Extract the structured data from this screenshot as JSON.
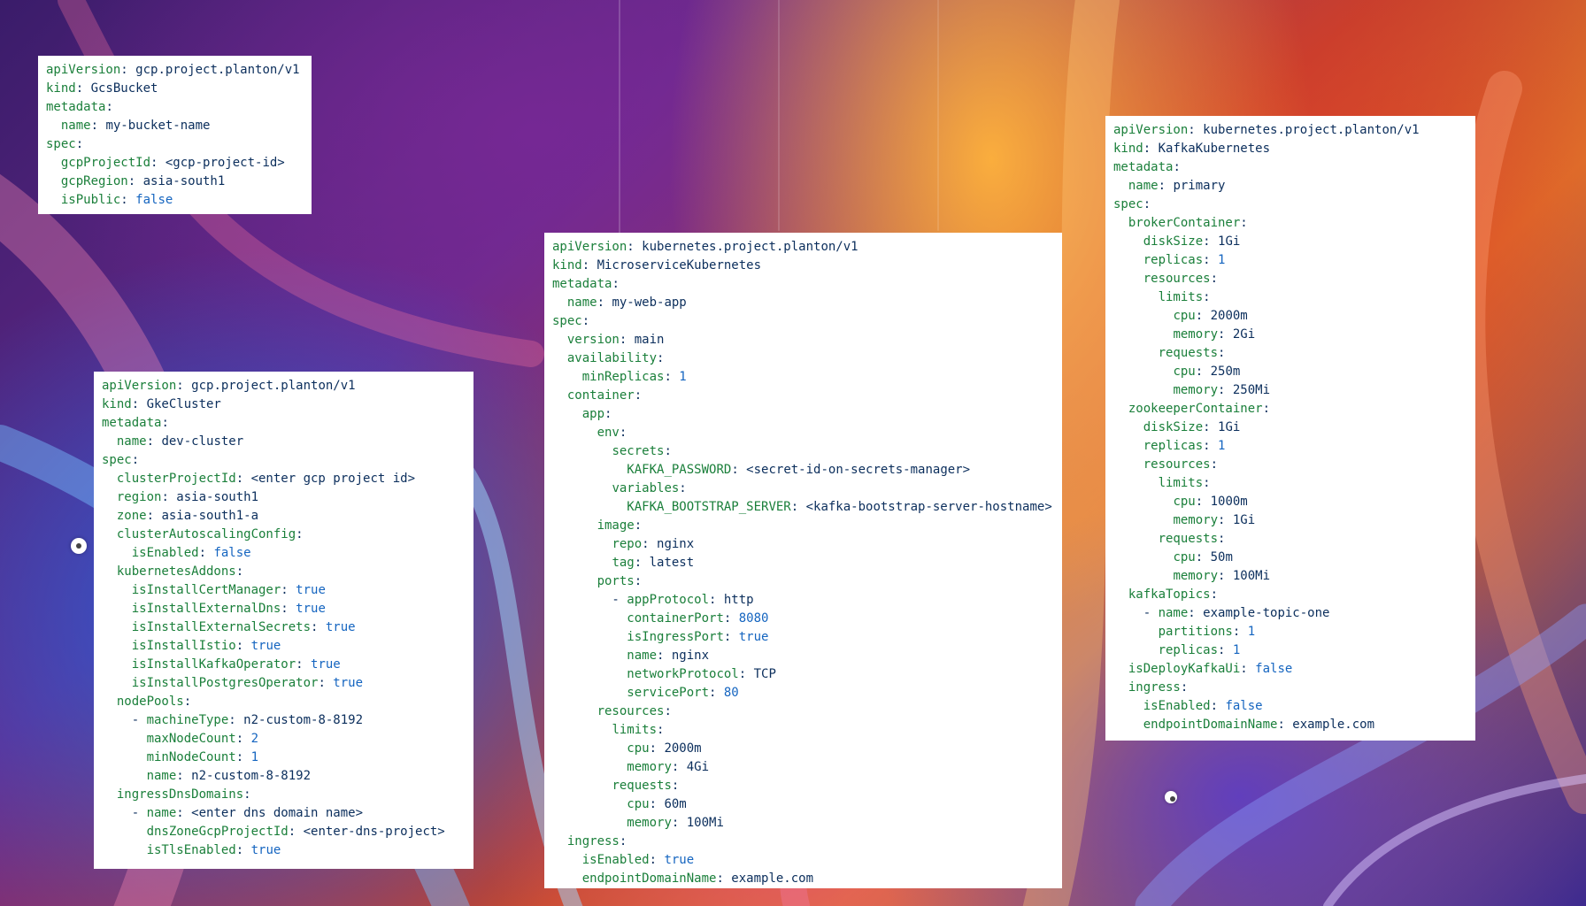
{
  "cards": {
    "gcs": {
      "lines": [
        {
          "indent": 0,
          "key": "apiVersion",
          "value": "gcp.project.planton/v1",
          "type": "s"
        },
        {
          "indent": 0,
          "key": "kind",
          "value": "GcsBucket",
          "type": "s"
        },
        {
          "indent": 0,
          "key": "metadata",
          "value": "",
          "type": "s"
        },
        {
          "indent": 1,
          "key": "name",
          "value": "my-bucket-name",
          "type": "s"
        },
        {
          "indent": 0,
          "key": "spec",
          "value": "",
          "type": "s"
        },
        {
          "indent": 1,
          "key": "gcpProjectId",
          "value": "<gcp-project-id>",
          "type": "s"
        },
        {
          "indent": 1,
          "key": "gcpRegion",
          "value": "asia-south1",
          "type": "s"
        },
        {
          "indent": 1,
          "key": "isPublic",
          "value": "false",
          "type": "n"
        }
      ]
    },
    "gke": {
      "lines": [
        {
          "indent": 0,
          "key": "apiVersion",
          "value": "gcp.project.planton/v1",
          "type": "s"
        },
        {
          "indent": 0,
          "key": "kind",
          "value": "GkeCluster",
          "type": "s"
        },
        {
          "indent": 0,
          "key": "metadata",
          "value": "",
          "type": "s"
        },
        {
          "indent": 1,
          "key": "name",
          "value": "dev-cluster",
          "type": "s"
        },
        {
          "indent": 0,
          "key": "spec",
          "value": "",
          "type": "s"
        },
        {
          "indent": 1,
          "key": "clusterProjectId",
          "value": "<enter gcp project id>",
          "type": "s"
        },
        {
          "indent": 1,
          "key": "region",
          "value": "asia-south1",
          "type": "s"
        },
        {
          "indent": 1,
          "key": "zone",
          "value": "asia-south1-a",
          "type": "s"
        },
        {
          "indent": 1,
          "key": "clusterAutoscalingConfig",
          "value": "",
          "type": "s"
        },
        {
          "indent": 2,
          "key": "isEnabled",
          "value": "false",
          "type": "n"
        },
        {
          "indent": 1,
          "key": "kubernetesAddons",
          "value": "",
          "type": "s"
        },
        {
          "indent": 2,
          "key": "isInstallCertManager",
          "value": "true",
          "type": "n"
        },
        {
          "indent": 2,
          "key": "isInstallExternalDns",
          "value": "true",
          "type": "n"
        },
        {
          "indent": 2,
          "key": "isInstallExternalSecrets",
          "value": "true",
          "type": "n"
        },
        {
          "indent": 2,
          "key": "isInstallIstio",
          "value": "true",
          "type": "n"
        },
        {
          "indent": 2,
          "key": "isInstallKafkaOperator",
          "value": "true",
          "type": "n"
        },
        {
          "indent": 2,
          "key": "isInstallPostgresOperator",
          "value": "true",
          "type": "n"
        },
        {
          "indent": 1,
          "key": "nodePools",
          "value": "",
          "type": "s"
        },
        {
          "indent": 2,
          "dash": true,
          "key": "machineType",
          "value": "n2-custom-8-8192",
          "type": "s"
        },
        {
          "indent": 3,
          "key": "maxNodeCount",
          "value": "2",
          "type": "n"
        },
        {
          "indent": 3,
          "key": "minNodeCount",
          "value": "1",
          "type": "n"
        },
        {
          "indent": 3,
          "key": "name",
          "value": "n2-custom-8-8192",
          "type": "s"
        },
        {
          "indent": 1,
          "key": "ingressDnsDomains",
          "value": "",
          "type": "s"
        },
        {
          "indent": 2,
          "dash": true,
          "key": "name",
          "value": "<enter dns domain name>",
          "type": "s"
        },
        {
          "indent": 3,
          "key": "dnsZoneGcpProjectId",
          "value": "<enter-dns-project>",
          "type": "s"
        },
        {
          "indent": 3,
          "key": "isTlsEnabled",
          "value": "true",
          "type": "n"
        }
      ]
    },
    "micro": {
      "lines": [
        {
          "indent": 0,
          "key": "apiVersion",
          "value": "kubernetes.project.planton/v1",
          "type": "s"
        },
        {
          "indent": 0,
          "key": "kind",
          "value": "MicroserviceKubernetes",
          "type": "s"
        },
        {
          "indent": 0,
          "key": "metadata",
          "value": "",
          "type": "s"
        },
        {
          "indent": 1,
          "key": "name",
          "value": "my-web-app",
          "type": "s"
        },
        {
          "indent": 0,
          "key": "spec",
          "value": "",
          "type": "s"
        },
        {
          "indent": 1,
          "key": "version",
          "value": "main",
          "type": "s"
        },
        {
          "indent": 1,
          "key": "availability",
          "value": "",
          "type": "s"
        },
        {
          "indent": 2,
          "key": "minReplicas",
          "value": "1",
          "type": "n"
        },
        {
          "indent": 1,
          "key": "container",
          "value": "",
          "type": "s"
        },
        {
          "indent": 2,
          "key": "app",
          "value": "",
          "type": "s"
        },
        {
          "indent": 3,
          "key": "env",
          "value": "",
          "type": "s"
        },
        {
          "indent": 4,
          "key": "secrets",
          "value": "",
          "type": "s"
        },
        {
          "indent": 5,
          "key": "KAFKA_PASSWORD",
          "value": "<secret-id-on-secrets-manager>",
          "type": "s"
        },
        {
          "indent": 4,
          "key": "variables",
          "value": "",
          "type": "s"
        },
        {
          "indent": 5,
          "key": "KAFKA_BOOTSTRAP_SERVER",
          "value": "<kafka-bootstrap-server-hostname>",
          "type": "s"
        },
        {
          "indent": 3,
          "key": "image",
          "value": "",
          "type": "s"
        },
        {
          "indent": 4,
          "key": "repo",
          "value": "nginx",
          "type": "s"
        },
        {
          "indent": 4,
          "key": "tag",
          "value": "latest",
          "type": "s"
        },
        {
          "indent": 3,
          "key": "ports",
          "value": "",
          "type": "s"
        },
        {
          "indent": 4,
          "dash": true,
          "key": "appProtocol",
          "value": "http",
          "type": "s"
        },
        {
          "indent": 5,
          "key": "containerPort",
          "value": "8080",
          "type": "n"
        },
        {
          "indent": 5,
          "key": "isIngressPort",
          "value": "true",
          "type": "n"
        },
        {
          "indent": 5,
          "key": "name",
          "value": "nginx",
          "type": "s"
        },
        {
          "indent": 5,
          "key": "networkProtocol",
          "value": "TCP",
          "type": "s"
        },
        {
          "indent": 5,
          "key": "servicePort",
          "value": "80",
          "type": "n"
        },
        {
          "indent": 3,
          "key": "resources",
          "value": "",
          "type": "s"
        },
        {
          "indent": 4,
          "key": "limits",
          "value": "",
          "type": "s"
        },
        {
          "indent": 5,
          "key": "cpu",
          "value": "2000m",
          "type": "s"
        },
        {
          "indent": 5,
          "key": "memory",
          "value": "4Gi",
          "type": "s"
        },
        {
          "indent": 4,
          "key": "requests",
          "value": "",
          "type": "s"
        },
        {
          "indent": 5,
          "key": "cpu",
          "value": "60m",
          "type": "s"
        },
        {
          "indent": 5,
          "key": "memory",
          "value": "100Mi",
          "type": "s"
        },
        {
          "indent": 1,
          "key": "ingress",
          "value": "",
          "type": "s"
        },
        {
          "indent": 2,
          "key": "isEnabled",
          "value": "true",
          "type": "n"
        },
        {
          "indent": 2,
          "key": "endpointDomainName",
          "value": "example.com",
          "type": "s"
        }
      ]
    },
    "kafka": {
      "lines": [
        {
          "indent": 0,
          "key": "apiVersion",
          "value": "kubernetes.project.planton/v1",
          "type": "s"
        },
        {
          "indent": 0,
          "key": "kind",
          "value": "KafkaKubernetes",
          "type": "s"
        },
        {
          "indent": 0,
          "key": "metadata",
          "value": "",
          "type": "s"
        },
        {
          "indent": 1,
          "key": "name",
          "value": "primary",
          "type": "s"
        },
        {
          "indent": 0,
          "key": "spec",
          "value": "",
          "type": "s"
        },
        {
          "indent": 1,
          "key": "brokerContainer",
          "value": "",
          "type": "s"
        },
        {
          "indent": 2,
          "key": "diskSize",
          "value": "1Gi",
          "type": "s"
        },
        {
          "indent": 2,
          "key": "replicas",
          "value": "1",
          "type": "n"
        },
        {
          "indent": 2,
          "key": "resources",
          "value": "",
          "type": "s"
        },
        {
          "indent": 3,
          "key": "limits",
          "value": "",
          "type": "s"
        },
        {
          "indent": 4,
          "key": "cpu",
          "value": "2000m",
          "type": "s"
        },
        {
          "indent": 4,
          "key": "memory",
          "value": "2Gi",
          "type": "s"
        },
        {
          "indent": 3,
          "key": "requests",
          "value": "",
          "type": "s"
        },
        {
          "indent": 4,
          "key": "cpu",
          "value": "250m",
          "type": "s"
        },
        {
          "indent": 4,
          "key": "memory",
          "value": "250Mi",
          "type": "s"
        },
        {
          "indent": 1,
          "key": "zookeeperContainer",
          "value": "",
          "type": "s"
        },
        {
          "indent": 2,
          "key": "diskSize",
          "value": "1Gi",
          "type": "s"
        },
        {
          "indent": 2,
          "key": "replicas",
          "value": "1",
          "type": "n"
        },
        {
          "indent": 2,
          "key": "resources",
          "value": "",
          "type": "s"
        },
        {
          "indent": 3,
          "key": "limits",
          "value": "",
          "type": "s"
        },
        {
          "indent": 4,
          "key": "cpu",
          "value": "1000m",
          "type": "s"
        },
        {
          "indent": 4,
          "key": "memory",
          "value": "1Gi",
          "type": "s"
        },
        {
          "indent": 3,
          "key": "requests",
          "value": "",
          "type": "s"
        },
        {
          "indent": 4,
          "key": "cpu",
          "value": "50m",
          "type": "s"
        },
        {
          "indent": 4,
          "key": "memory",
          "value": "100Mi",
          "type": "s"
        },
        {
          "indent": 1,
          "key": "kafkaTopics",
          "value": "",
          "type": "s"
        },
        {
          "indent": 2,
          "dash": true,
          "key": "name",
          "value": "example-topic-one",
          "type": "s"
        },
        {
          "indent": 3,
          "key": "partitions",
          "value": "1",
          "type": "n"
        },
        {
          "indent": 3,
          "key": "replicas",
          "value": "1",
          "type": "n"
        },
        {
          "indent": 1,
          "key": "isDeployKafkaUi",
          "value": "false",
          "type": "n"
        },
        {
          "indent": 1,
          "key": "ingress",
          "value": "",
          "type": "s"
        },
        {
          "indent": 2,
          "key": "isEnabled",
          "value": "false",
          "type": "n"
        },
        {
          "indent": 2,
          "key": "endpointDomainName",
          "value": "example.com",
          "type": "s"
        }
      ]
    }
  },
  "colors": {
    "key": "#1a7f3a",
    "string": "#0b2e5c",
    "literal": "#1565c0"
  }
}
